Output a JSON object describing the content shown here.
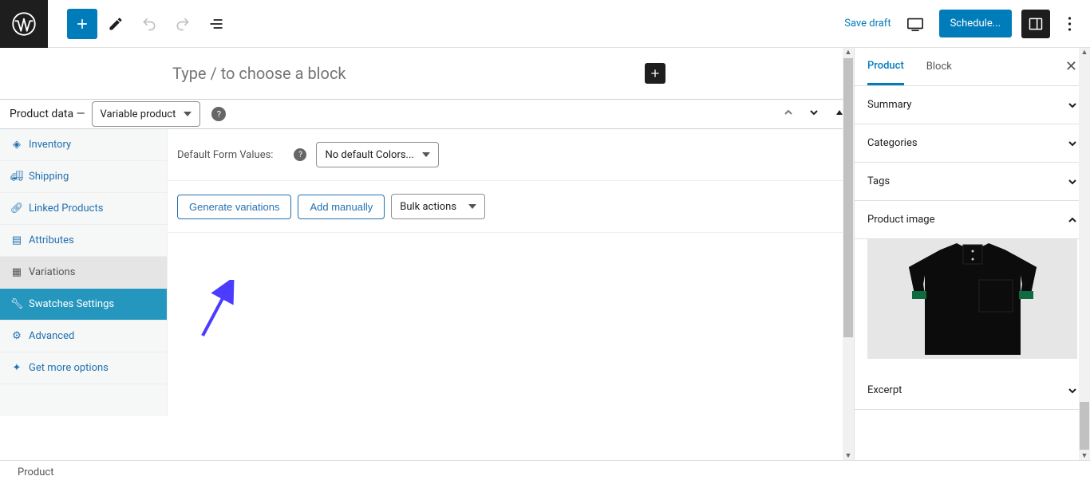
{
  "top": {
    "save_draft": "Save draft",
    "schedule": "Schedule..."
  },
  "block_placeholder": "Type / to choose a block",
  "product_data": {
    "label": "Product data —",
    "type_selected": "Variable product",
    "tabs": [
      {
        "icon": "tag",
        "label": "Inventory"
      },
      {
        "icon": "truck",
        "label": "Shipping"
      },
      {
        "icon": "link",
        "label": "Linked Products"
      },
      {
        "icon": "list",
        "label": "Attributes"
      },
      {
        "icon": "grid",
        "label": "Variations"
      },
      {
        "icon": "wrench",
        "label": "Swatches Settings"
      },
      {
        "icon": "gear",
        "label": "Advanced"
      },
      {
        "icon": "plus",
        "label": "Get more options"
      }
    ],
    "default_form_label": "Default Form Values:",
    "default_form_selected": "No default Colors...",
    "generate_btn": "Generate variations",
    "add_manually_btn": "Add manually",
    "bulk_actions_selected": "Bulk actions"
  },
  "sidebar": {
    "tabs": [
      "Product",
      "Block"
    ],
    "sections": {
      "summary": "Summary",
      "categories": "Categories",
      "tags": "Tags",
      "product_image": "Product image",
      "excerpt": "Excerpt"
    }
  },
  "footer": {
    "breadcrumb": "Product"
  }
}
